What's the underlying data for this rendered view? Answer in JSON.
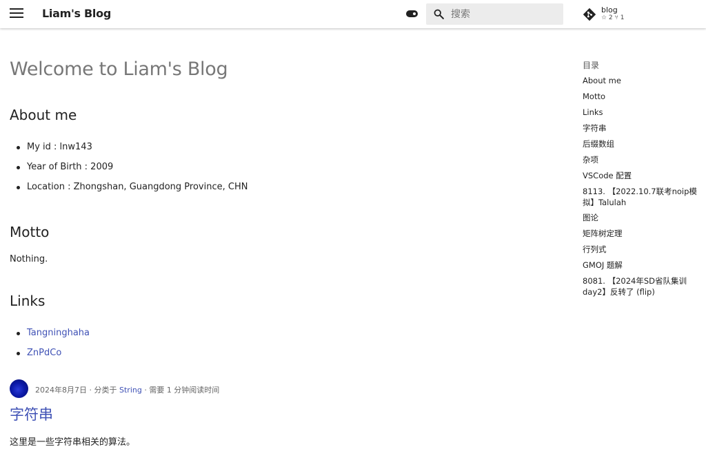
{
  "header": {
    "site_title": "Liam's Blog",
    "search_placeholder": "搜索",
    "repo": {
      "name": "blog",
      "stars": "☆ 2",
      "forks": "⑂ 1"
    }
  },
  "main": {
    "page_title": "Welcome to Liam's Blog",
    "about": {
      "heading": "About me",
      "items": [
        "My id : lnw143",
        "Year of Birth : 2009",
        "Location : Zhongshan, Guangdong Province, CHN"
      ]
    },
    "motto": {
      "heading": "Motto",
      "text": "Nothing."
    },
    "links": {
      "heading": "Links",
      "items": [
        "Tangninghaha",
        "ZnPdCo"
      ]
    },
    "post": {
      "date": "2024年8月7日",
      "category_prefix": " · 分类于 ",
      "category": "String",
      "reading_time": " · 需要 1 分钟阅读时间",
      "title": "字符串",
      "excerpt": "这里是一些字符串相关的算法。"
    }
  },
  "toc": {
    "title": "目录",
    "items": [
      "About me",
      "Motto",
      "Links",
      "字符串",
      "后缀数组",
      "杂项",
      "VSCode 配置",
      "8113. 【2022.10.7联考noip模拟】Talulah",
      "图论",
      "矩阵树定理",
      "行列式",
      "GMOJ 题解",
      "8081. 【2024年SD省队集训 day2】反转了 (flip)"
    ]
  },
  "colors": {
    "link": "#3f51b5",
    "search_bg": "#ececec",
    "avatar": "#0c1aa8"
  },
  "icons": [
    "menu-icon",
    "theme-toggle-icon",
    "search-icon",
    "git-icon",
    "star-icon",
    "fork-icon"
  ]
}
